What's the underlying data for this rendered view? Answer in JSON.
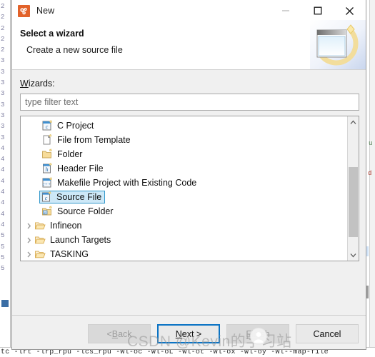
{
  "window": {
    "title": "New",
    "icon": "wizard-app-icon",
    "controls": {
      "minimize": "—",
      "maximize": "□",
      "close": "✕"
    }
  },
  "header": {
    "title": "Select a wizard",
    "subtitle": "Create a new source file",
    "banner_icon": "wizard-banner-image"
  },
  "form": {
    "wizards_label_prefix": "W",
    "wizards_label_rest": "izards:",
    "filter_placeholder": "type filter text",
    "filter_value": ""
  },
  "tree": {
    "items": [
      {
        "label": "C Project",
        "icon": "c-project-icon",
        "indent": 1,
        "expandable": false,
        "selected": false
      },
      {
        "label": "File from Template",
        "icon": "file-icon",
        "indent": 1,
        "expandable": false,
        "selected": false
      },
      {
        "label": "Folder",
        "icon": "folder-icon",
        "indent": 1,
        "expandable": false,
        "selected": false
      },
      {
        "label": "Header File",
        "icon": "header-file-icon",
        "indent": 1,
        "expandable": false,
        "selected": false
      },
      {
        "label": "Makefile Project with Existing Code",
        "icon": "cpp-project-icon",
        "indent": 1,
        "expandable": false,
        "selected": false
      },
      {
        "label": "Source File",
        "icon": "source-file-icon",
        "indent": 1,
        "expandable": false,
        "selected": true
      },
      {
        "label": "Source Folder",
        "icon": "source-folder-icon",
        "indent": 1,
        "expandable": false,
        "selected": false
      },
      {
        "label": "Infineon",
        "icon": "open-folder-icon",
        "indent": 0,
        "expandable": true,
        "selected": false
      },
      {
        "label": "Launch Targets",
        "icon": "open-folder-icon",
        "indent": 0,
        "expandable": true,
        "selected": false
      },
      {
        "label": "TASKING",
        "icon": "open-folder-icon",
        "indent": 0,
        "expandable": true,
        "selected": false
      }
    ],
    "scrollbar": {
      "up_icon": "chevron-up-icon",
      "down_icon": "chevron-down-icon"
    }
  },
  "footer": {
    "back": {
      "prefix": "< ",
      "accel": "B",
      "rest": "ack",
      "state": "disabled"
    },
    "next": {
      "prefix": "",
      "accel": "N",
      "rest": "ext >",
      "state": "default"
    },
    "finish": {
      "prefix": "",
      "accel": "F",
      "rest": "inish",
      "state": "disabled"
    },
    "cancel": {
      "prefix": "",
      "accel": "",
      "rest": "Cancel",
      "state": "normal"
    }
  },
  "watermark": {
    "text": "CSDN @Kevin的学习站"
  },
  "background": {
    "gutter_lines": [
      "2",
      "2",
      "2",
      "2",
      "2",
      "3",
      "3",
      "3",
      "3",
      "3",
      "3",
      "3",
      "3",
      "4",
      "4",
      "4",
      "4",
      "4",
      "4",
      "4",
      "4",
      "5",
      "5",
      "5",
      "5"
    ],
    "code_line": "tc -lrt -lrp_rpu -lcs_rpu  -Wl-oc -Wl-oL -Wl-ot -Wl-ox -Wl-oy -Wl--map-file"
  },
  "colors": {
    "accent": "#0a73c4",
    "selection_bg": "#cde8f7",
    "selection_border": "#3399cc",
    "dialog_bg": "#f0f0f0",
    "title_icon": "#e2622a"
  }
}
